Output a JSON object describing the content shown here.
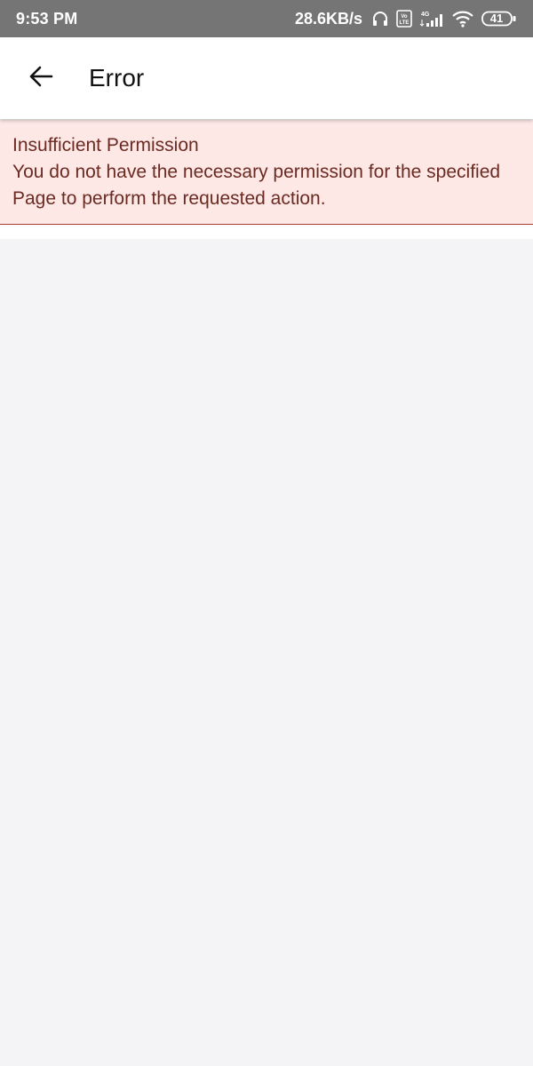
{
  "status_bar": {
    "time": "9:53 PM",
    "network_speed": "28.6KB/s",
    "battery_level": "41",
    "icons": [
      "headphones-icon",
      "volte-icon",
      "signal-4g-icon",
      "wifi-icon",
      "battery-icon"
    ]
  },
  "app_bar": {
    "back_icon": "arrow-left-icon",
    "title": "Error"
  },
  "error": {
    "title": "Insufficient Permission",
    "message": "You do not have the necessary permission for the specified Page to perform the requested action.",
    "colors": {
      "background": "#fde8e6",
      "text": "#6b2a22",
      "border": "#a83a2f"
    }
  },
  "colors": {
    "status_bar": "#757575",
    "app_bar": "#ffffff",
    "page_background": "#f4f4f6"
  }
}
